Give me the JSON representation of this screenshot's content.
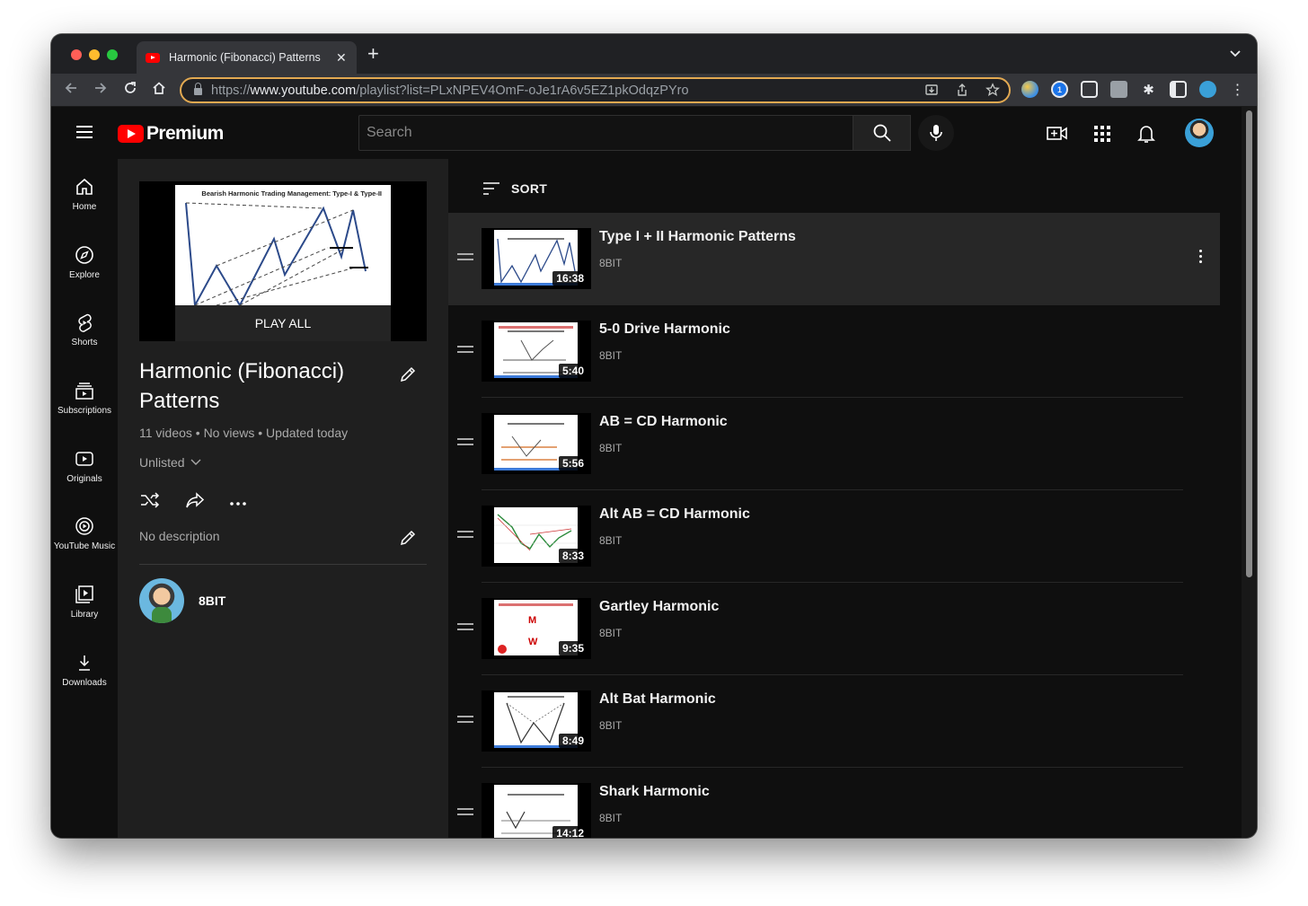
{
  "browser": {
    "tab_title": "Harmonic (Fibonacci) Patterns",
    "new_tab_symbol": "+",
    "url_scheme": "https://",
    "url_host": "www.youtube.com",
    "url_path": "/playlist?list=PLxNPEV4OmF-oJe1rA6v5EZ1pkOdqzPYro"
  },
  "masthead": {
    "logo_text": "Premium",
    "search_placeholder": "Search"
  },
  "guide": [
    {
      "label": "Home",
      "icon": "home-icon"
    },
    {
      "label": "Explore",
      "icon": "compass-icon"
    },
    {
      "label": "Shorts",
      "icon": "shorts-icon"
    },
    {
      "label": "Subscriptions",
      "icon": "subscriptions-icon"
    },
    {
      "label": "Originals",
      "icon": "originals-icon"
    },
    {
      "label": "YouTube Music",
      "icon": "music-icon"
    },
    {
      "label": "Library",
      "icon": "library-icon"
    },
    {
      "label": "Downloads",
      "icon": "download-icon"
    }
  ],
  "playlist": {
    "thumbnail_caption": "Bearish Harmonic Trading Management: Type-I & Type-II",
    "play_all": "PLAY ALL",
    "title": "Harmonic (Fibonacci) Patterns",
    "stats": "11 videos • No views • Updated today",
    "privacy": "Unlisted",
    "description": "No description",
    "owner": "8BIT"
  },
  "sort_label": "SORT",
  "videos": [
    {
      "title": "Type I + II Harmonic Patterns",
      "channel": "8BIT",
      "duration": "16:38"
    },
    {
      "title": "5-0 Drive Harmonic",
      "channel": "8BIT",
      "duration": "5:40"
    },
    {
      "title": "AB = CD Harmonic",
      "channel": "8BIT",
      "duration": "5:56"
    },
    {
      "title": "Alt AB = CD Harmonic",
      "channel": "8BIT",
      "duration": "8:33"
    },
    {
      "title": "Gartley Harmonic",
      "channel": "8BIT",
      "duration": "9:35"
    },
    {
      "title": "Alt Bat Harmonic",
      "channel": "8BIT",
      "duration": "8:49"
    },
    {
      "title": "Shark Harmonic",
      "channel": "8BIT",
      "duration": "14:12"
    }
  ],
  "colors": {
    "accent_red": "#ff0000",
    "omnibox_focus": "#e2a951",
    "background": "#0f0f0f",
    "panel": "#1f1f1f"
  }
}
